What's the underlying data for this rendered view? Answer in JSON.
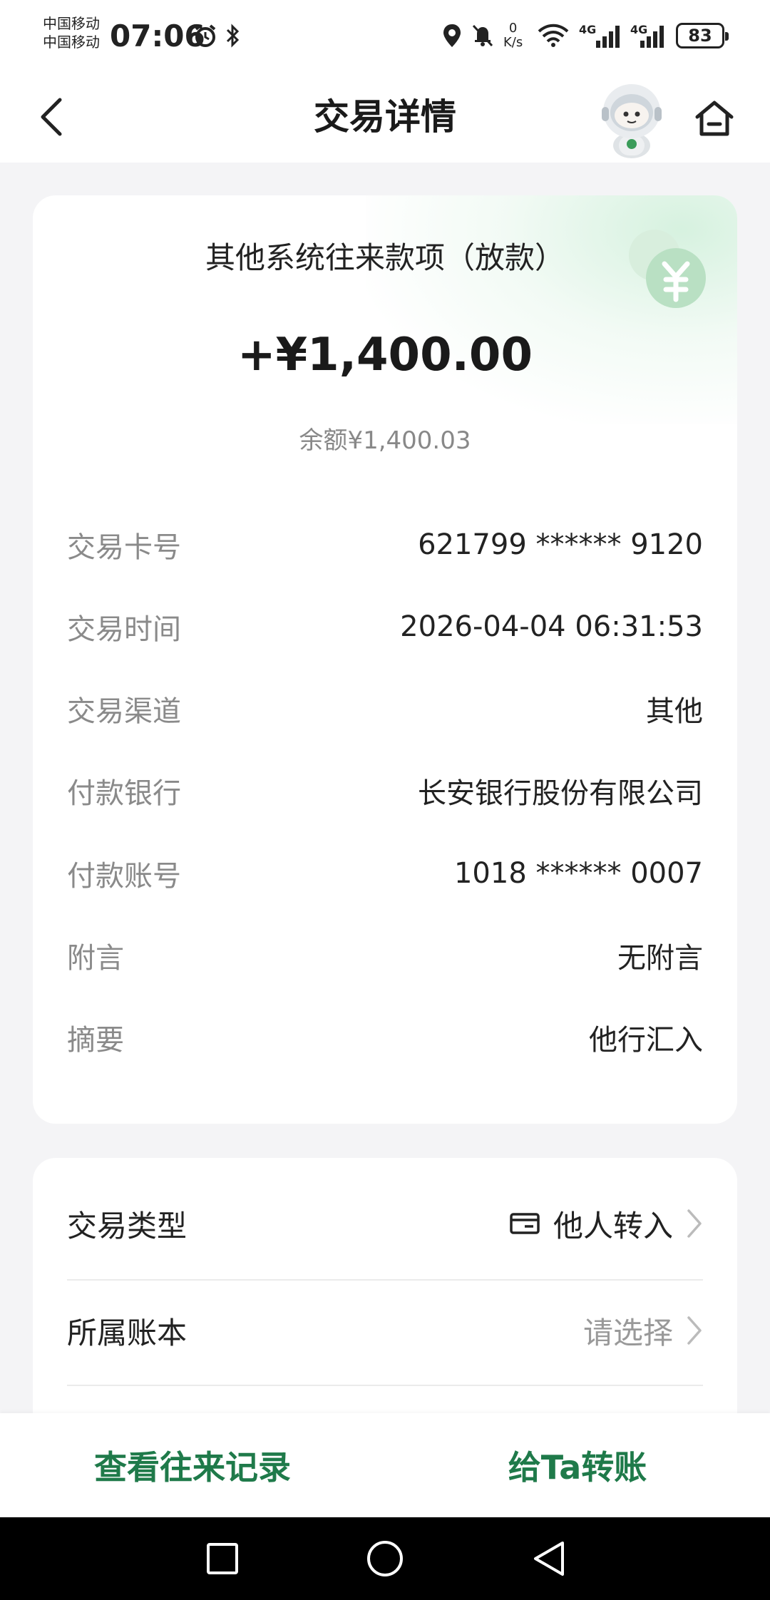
{
  "status_bar": {
    "carrier_1": "中国移动",
    "carrier_2": "中国移动",
    "time": "07:06",
    "net_speed_value": "0",
    "net_speed_unit": "K/s",
    "signal_1_label": "4G",
    "signal_2_label": "4G",
    "battery": "83",
    "icons": [
      "alarm-icon",
      "bluetooth-icon",
      "location-icon",
      "mute-icon",
      "wifi-icon",
      "signal-icon",
      "battery-icon"
    ]
  },
  "header": {
    "title": "交易详情",
    "back_icon": "chevron-left-icon",
    "home_icon": "home-icon"
  },
  "transaction": {
    "title": "其他系统往来款项（放款）",
    "amount": "+¥1,400.00",
    "balance": "余额¥1,400.03",
    "details": [
      {
        "label": "交易卡号",
        "value": "621799 ****** 9120"
      },
      {
        "label": "交易时间",
        "value": "2026-04-04 06:31:53"
      },
      {
        "label": "交易渠道",
        "value": "其他"
      },
      {
        "label": "付款银行",
        "value": "长安银行股份有限公司"
      },
      {
        "label": "付款账号",
        "value": "1018 ****** 0007"
      },
      {
        "label": "附言",
        "value": "无附言"
      },
      {
        "label": "摘要",
        "value": "他行汇入"
      }
    ]
  },
  "options": {
    "type_label": "交易类型",
    "type_value": "他人转入",
    "ledger_label": "所属账本",
    "ledger_value": "请选择"
  },
  "actions": {
    "view_records": "查看往来记录",
    "transfer": "给Ta转账"
  },
  "colors": {
    "accent": "#1f7a4a",
    "background": "#f4f4f6",
    "card": "#ffffff",
    "label_gray": "#8a8a8a"
  }
}
